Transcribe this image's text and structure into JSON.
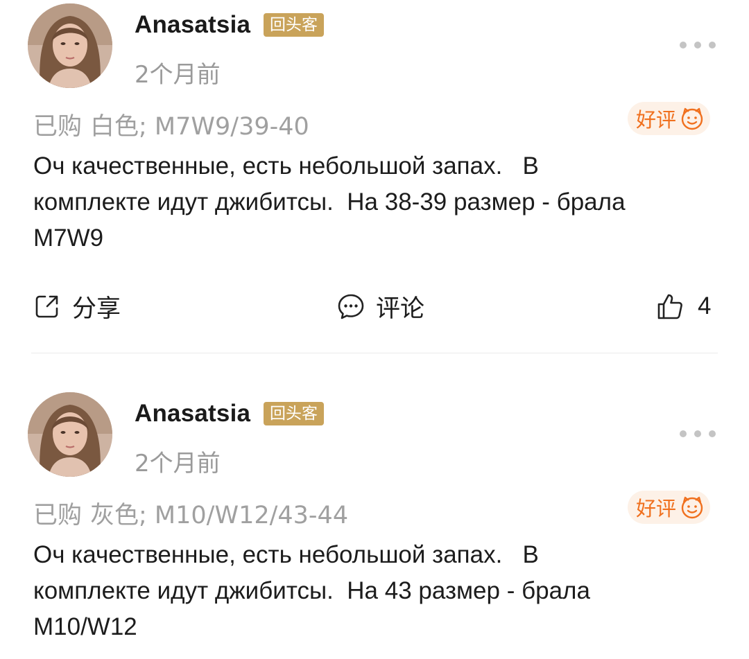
{
  "colors": {
    "badge_bg": "#c9a35a",
    "rating_accent": "#f0701e",
    "rating_bg": "#fdf1e7",
    "muted_text": "#9a9a9a"
  },
  "reviews": [
    {
      "username": "Anasatsia",
      "badge": "回头客",
      "time": "2个月前",
      "purchase_prefix": "已购",
      "purchase_spec": "白色; M7W9/39-40",
      "rating_label": "好评",
      "rating_icon": "smile-face-icon",
      "content_line1": "Оч качественные, есть небольшой запах.   В",
      "content_line2": "комплекте идут джибитсы.  На 38-39 размер - брала",
      "content_line3": "M7W9",
      "share_label": "分享",
      "comment_label": "评论",
      "like_count": "4"
    },
    {
      "username": "Anasatsia",
      "badge": "回头客",
      "time": "2个月前",
      "purchase_prefix": "已购",
      "purchase_spec": "灰色; M10/W12/43-44",
      "rating_label": "好评",
      "rating_icon": "smile-face-icon",
      "content_line1": "Оч качественные, есть небольшой запах.   В",
      "content_line2": "комплекте идут джибитсы.  На 43 размер - брала",
      "content_line3": "M10/W12"
    }
  ]
}
